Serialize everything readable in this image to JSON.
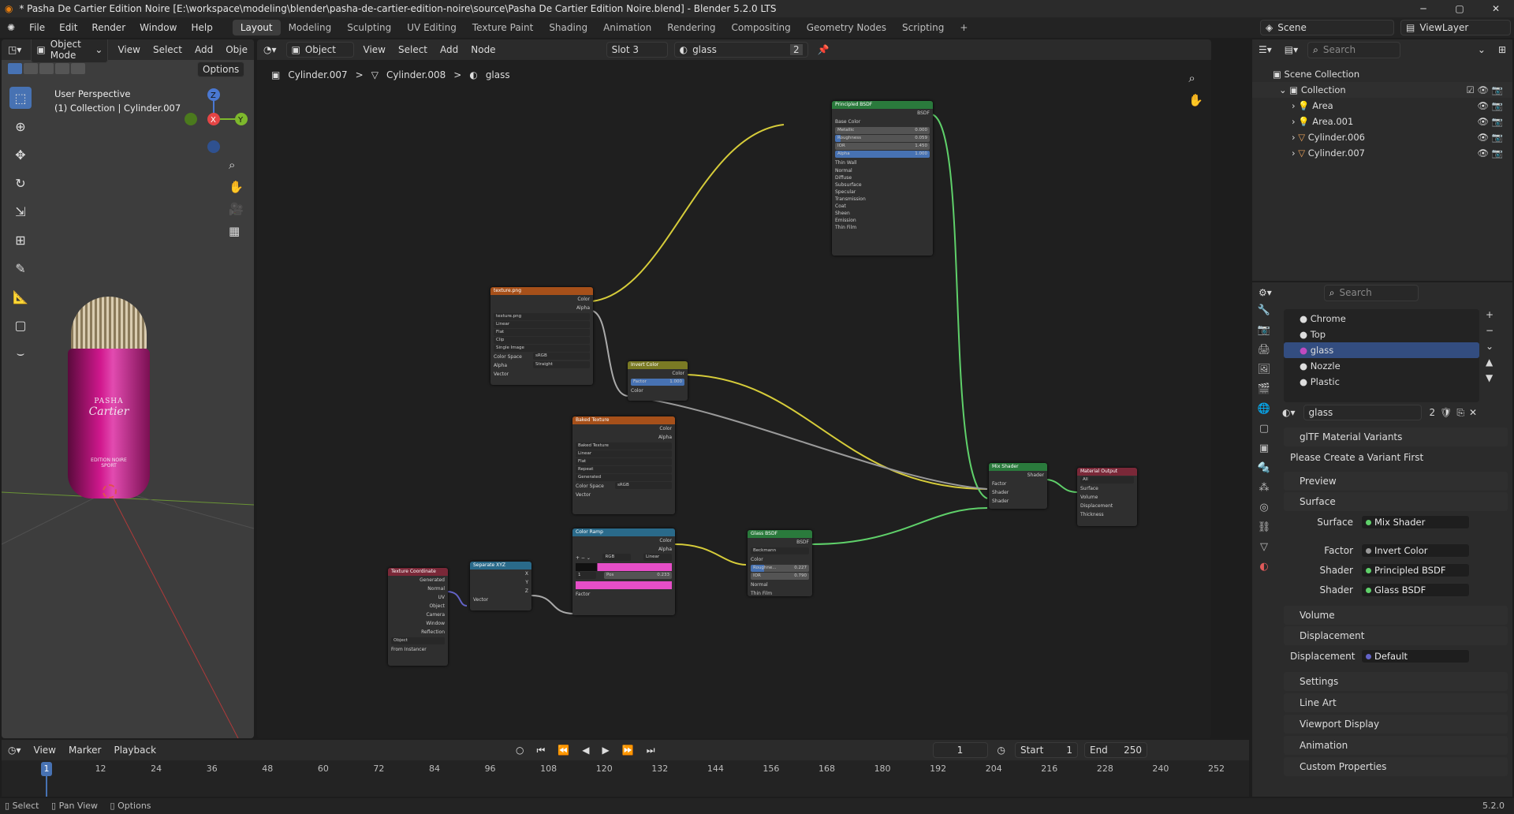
{
  "window": {
    "title": "* Pasha De Cartier Edition Noire [E:\\workspace\\modeling\\blender\\pasha-de-cartier-edition-noire\\source\\Pasha De Cartier Edition Noire.blend] - Blender 5.2.0 LTS",
    "minimize": "─",
    "maximize": "▢",
    "close": "✕"
  },
  "menu": {
    "items": [
      "File",
      "Edit",
      "Render",
      "Window",
      "Help"
    ],
    "workspaces": [
      "Layout",
      "Modeling",
      "Sculpting",
      "UV Editing",
      "Texture Paint",
      "Shading",
      "Animation",
      "Rendering",
      "Compositing",
      "Geometry Nodes",
      "Scripting"
    ],
    "add_tab": "+",
    "scene_label": "Scene",
    "view_layer_label": "ViewLayer"
  },
  "viewport": {
    "mode": "Object Mode",
    "menu": [
      "View",
      "Select",
      "Add",
      "Obje"
    ],
    "options_label": "Options",
    "perspective": "User Perspective",
    "collection_info": "(1) Collection | Cylinder.007",
    "gizmo_axes": {
      "z": "Z",
      "x": "X",
      "y": "Y"
    },
    "bottle_brand_line1": "PASHA",
    "bottle_brand_line2": "Cartier",
    "bottle_sub_line1": "EDITION NOIRE",
    "bottle_sub_line2": "SPORT",
    "colors": {
      "background": "#3d3d3d",
      "bottle_pink": "#d1188e"
    }
  },
  "node_editor": {
    "object_dropdown": "Object",
    "menu": [
      "View",
      "Select",
      "Add",
      "Node"
    ],
    "slot": "Slot 3",
    "material_name": "glass",
    "user_count": "2",
    "breadcrumb": [
      "Cylinder.007",
      "Cylinder.008",
      "glass"
    ],
    "breadcrumb_sep": ">",
    "nodes": {
      "principled": {
        "title": "Principled BSDF",
        "out": "BSDF",
        "base_color": "Base Color",
        "metallic": "Metallic",
        "metallic_val": "0.000",
        "roughness": "Roughness",
        "roughness_val": "0.059",
        "ior": "IOR",
        "ior_val": "1.450",
        "alpha": "Alpha",
        "alpha_val": "1.000",
        "thin_walled": "Thin Wall",
        "normal": "Normal",
        "panels": [
          "Diffuse",
          "Subsurface",
          "Specular",
          "Transmission",
          "Coat",
          "Sheen",
          "Emission",
          "Thin Film"
        ]
      },
      "texture": {
        "title": "texture.png",
        "out_color": "Color",
        "out_alpha": "Alpha",
        "image": "texture.png",
        "interp": "Linear",
        "proj": "Flat",
        "ext": "Clip",
        "source": "Single Image",
        "colorspace_label": "Color Space",
        "colorspace": "sRGB",
        "alpha_label": "Alpha",
        "alpha_mode": "Straight",
        "vector": "Vector"
      },
      "invert": {
        "title": "Invert Color",
        "out": "Color",
        "factor": "Factor",
        "factor_val": "1.000",
        "color": "Color"
      },
      "baked": {
        "title": "Baked Texture",
        "out_color": "Color",
        "out_alpha": "Alpha",
        "image": "Baked Texture",
        "interp": "Linear",
        "proj": "Flat",
        "ext": "Repeat",
        "source": "Generated",
        "colorspace_label": "Color Space",
        "colorspace": "sRGB",
        "vector": "Vector"
      },
      "ramp": {
        "title": "Color Ramp",
        "out_color": "Color",
        "out_alpha": "Alpha",
        "mode": "RGB",
        "interp": "Linear",
        "index": "1",
        "pos_label": "Pos",
        "pos_val": "0.233",
        "factor": "Factor"
      },
      "glass": {
        "title": "Glass BSDF",
        "out": "BSDF",
        "dist": "Beckmann",
        "color": "Color",
        "roughness": "Roughne...",
        "roughness_val": "0.227",
        "ior": "IOR",
        "ior_val": "0.790",
        "normal": "Normal",
        "thin_film": "Thin Film"
      },
      "mix": {
        "title": "Mix Shader",
        "out": "Shader",
        "factor": "Factor",
        "shader1": "Shader",
        "shader2": "Shader"
      },
      "output": {
        "title": "Material Output",
        "target": "All",
        "surface": "Surface",
        "volume": "Volume",
        "displacement": "Displacement",
        "thickness": "Thickness"
      },
      "texcoord": {
        "title": "Texture Coordinate",
        "outs": [
          "Generated",
          "Normal",
          "UV",
          "Object",
          "Camera",
          "Window",
          "Reflection"
        ],
        "object": "Object",
        "from_instancer": "From Instancer"
      },
      "separate": {
        "title": "Separate XYZ",
        "outs": [
          "X",
          "Y",
          "Z"
        ],
        "vector": "Vector"
      }
    }
  },
  "outliner": {
    "search_placeholder": "Search",
    "scene_collection": "Scene Collection",
    "collection": "Collection",
    "items": [
      "Area",
      "Area.001",
      "Cylinder.006",
      "Cylinder.007"
    ]
  },
  "properties": {
    "search_placeholder": "Search",
    "material_slots": [
      "Chrome",
      "Top",
      "glass",
      "Nozzle",
      "Plastic"
    ],
    "selected_slot": "glass",
    "material_name": "glass",
    "user_count": "2",
    "gltf_section": "glTF Material Variants",
    "gltf_msg": "Please Create a Variant First",
    "preview": "Preview",
    "surface_section": "Surface",
    "surface_label": "Surface",
    "surface_value": "Mix Shader",
    "factor_label": "Factor",
    "factor_value": "Invert Color",
    "shader1_label": "Shader",
    "shader1_value": "Principled BSDF",
    "shader2_label": "Shader",
    "shader2_value": "Glass BSDF",
    "volume": "Volume",
    "displacement_section": "Displacement",
    "displacement_label": "Displacement",
    "displacement_value": "Default",
    "settings": "Settings",
    "line_art": "Line Art",
    "viewport_display": "Viewport Display",
    "animation": "Animation",
    "custom_properties": "Custom Properties"
  },
  "timeline": {
    "menu": [
      "View",
      "Marker",
      "Playback"
    ],
    "current_frame": "1",
    "start_label": "Start",
    "start": "1",
    "end_label": "End",
    "end": "250",
    "ticks": [
      "1",
      "12",
      "24",
      "36",
      "48",
      "60",
      "72",
      "84",
      "96",
      "108",
      "120",
      "132",
      "144",
      "156",
      "168",
      "180",
      "192",
      "204",
      "216",
      "228",
      "240",
      "252"
    ]
  },
  "status": {
    "select": "Select",
    "pan": "Pan View",
    "options": "Options",
    "version": "5.2.0"
  },
  "colors": {
    "link_yellow": "#d6cc3a",
    "link_green": "#5fd06a",
    "link_grey": "#9a9a9a",
    "link_blue": "#6363c7",
    "selected_blue": "#334d80"
  }
}
